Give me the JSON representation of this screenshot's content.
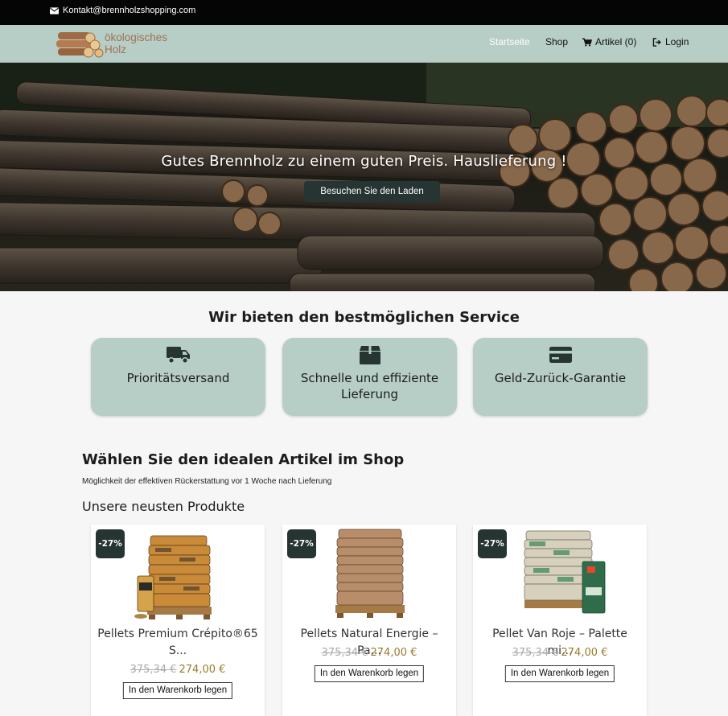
{
  "topbar": {
    "contact_email": "Kontakt@brennholzshopping.com"
  },
  "logo": {
    "line1": "ökologisches",
    "line2": "Holz"
  },
  "nav": {
    "home": "Startseite",
    "shop": "Shop",
    "cart": "Artikel (0)",
    "login": "Login"
  },
  "hero": {
    "headline": "Gutes Brennholz zu einem guten Preis. Hauslieferung !",
    "cta": "Besuchen Sie den Laden"
  },
  "services": {
    "title": "Wir bieten den bestmöglichen Service",
    "items": [
      {
        "icon": "truck-icon",
        "label": "Prioritätsversand"
      },
      {
        "icon": "box-icon",
        "label_line1": "Schnelle und effiziente",
        "label_line2": "Lieferung"
      },
      {
        "icon": "credit-card-icon",
        "label": "Geld-Zurück-Garantie"
      }
    ]
  },
  "shop": {
    "title": "Wählen Sie den idealen Artikel im Shop",
    "subtitle": "Möglichkeit der effektiven Rückerstattung vor 1 Woche nach Lieferung",
    "newest_title": "Unsere neusten Produkte"
  },
  "products": [
    {
      "badge": "-27%",
      "name_line1": "Pellets Premium Crépito®65",
      "name_line2": "S...",
      "old_price": "375,34 €",
      "price": "274,00 €",
      "add_label": "In den Warenkorb legen"
    },
    {
      "badge": "-27%",
      "name_line1": "Pellets Natural Energie – Pa...",
      "old_price": "375,34 €",
      "price": "274,00 €",
      "add_label": "In den Warenkorb legen"
    },
    {
      "badge": "-27%",
      "name_line1": "Pellet Van Roje – Palette mi...",
      "old_price": "375,34 €",
      "price": "274,00 €",
      "add_label": "In den Warenkorb legen"
    }
  ],
  "colors": {
    "nav_bg": "#b7cec6",
    "dark_accent": "#263432",
    "price": "#9c7a2c",
    "topbar": "#050505"
  }
}
